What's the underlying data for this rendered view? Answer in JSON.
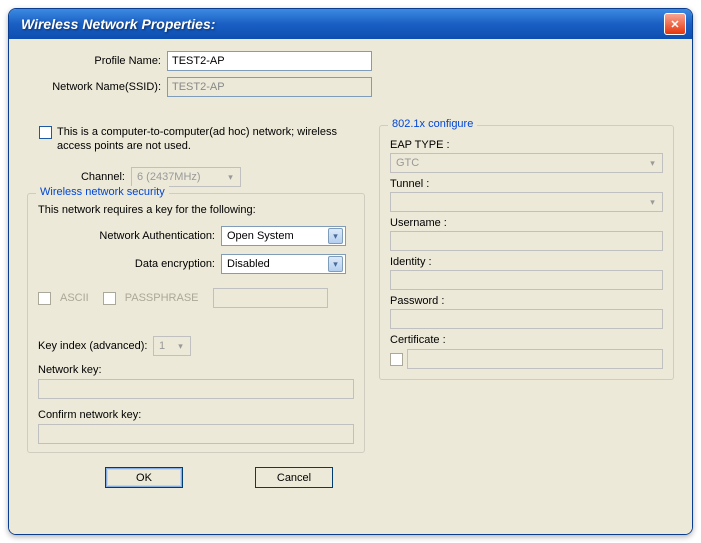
{
  "title": "Wireless Network Properties:",
  "labels": {
    "profileName": "Profile Name:",
    "ssid": "Network Name(SSID):",
    "adhoc": "This is a computer-to-computer(ad hoc) network; wireless access points are not used.",
    "channel": "Channel:",
    "securityLegend": "Wireless network security",
    "securityText": "This network requires a key for the following:",
    "netAuth": "Network Authentication:",
    "dataEnc": "Data encryption:",
    "ascii": "ASCII",
    "passphrase": "PASSPHRASE",
    "keyIndex": "Key index (advanced):",
    "netKey": "Network key:",
    "confirmKey": "Confirm network key:",
    "dot1xLegend": "802.1x configure",
    "eapType": "EAP TYPE :",
    "tunnel": "Tunnel :",
    "username": "Username :",
    "identity": "Identity :",
    "password": "Password :",
    "certificate": "Certificate :"
  },
  "values": {
    "profileName": "TEST2-AP",
    "ssid": "TEST2-AP",
    "channel": "6  (2437MHz)",
    "netAuth": "Open System",
    "dataEnc": "Disabled",
    "keyIndex": "1",
    "eapType": "GTC"
  },
  "buttons": {
    "ok": "OK",
    "cancel": "Cancel"
  }
}
